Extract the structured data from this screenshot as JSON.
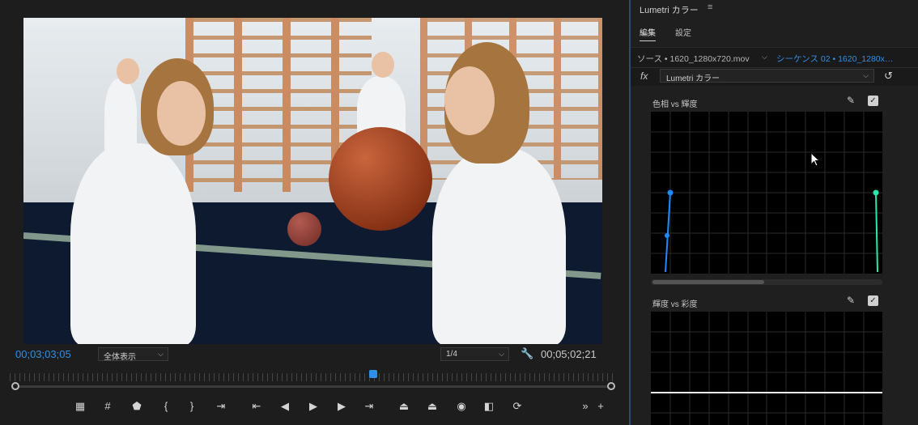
{
  "monitor": {
    "timecode_current": "00;03;03;05",
    "timecode_duration": "00;05;02;21",
    "zoom_select": "全体表示",
    "resolution_select": "1/4",
    "transport_icons": [
      "add-marker-icon",
      "mark-in-icon",
      "marker-icon",
      "mark-in-bracket-icon",
      "mark-out-bracket-icon",
      "go-to-in-icon",
      "go-to-previous-edit-icon",
      "step-back-icon",
      "play-icon",
      "step-forward-icon",
      "go-to-next-edit-icon",
      "lift-icon",
      "extract-icon",
      "export-frame-icon",
      "comparison-view-icon",
      "proxy-toggle-icon",
      "more-icon",
      "add-button-icon"
    ]
  },
  "lumetri": {
    "title": "Lumetri カラー",
    "tabs": [
      "編集",
      "設定"
    ],
    "active_tab": "編集",
    "source_label": "ソース • 1620_1280x720.mov",
    "sequence_label": "シーケンス 02 • 1620_1280x…",
    "fx_label": "fx",
    "effect_select": "Lumetri カラー",
    "curve1_label": "色相 vs 輝度",
    "curve2_label": "輝度 vs 彩度",
    "accent_color": "#2f8fe8"
  }
}
